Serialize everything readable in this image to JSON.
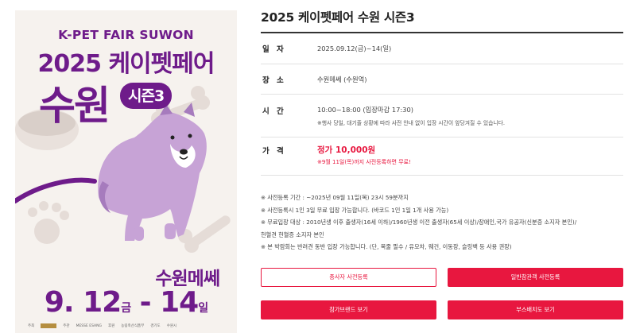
{
  "poster": {
    "title_en": "K-PET FAIR SUWON",
    "title_ko": "2025 케이펫페어",
    "city": "수원",
    "season": "시즌3",
    "venue": "수원메쎄",
    "date_start": "9. 12",
    "date_start_day": "금",
    "date_sep": " - ",
    "date_end": "14",
    "date_end_day": "일",
    "sponsors": [
      "주최",
      "주관",
      "MESSE ESANG",
      "후원",
      "농림축산식품부",
      "경기도",
      "수원시"
    ],
    "colors": {
      "brand": "#6e1b8a",
      "dog": "#c7a3d6",
      "background": "#f6f2ee"
    }
  },
  "event": {
    "title": "2025 케이펫페어 수원 시즌3",
    "rows": {
      "date": {
        "label": "일 자",
        "value": "2025.09.12(금)~14(일)"
      },
      "place": {
        "label": "장 소",
        "value": "수원메쎄 (수원역)"
      },
      "time": {
        "label": "시 간",
        "value": "10:00~18:00 (입장마감 17:30)",
        "note": "※행사 당일, 대기줄 상황에 따라 사전 안내 없이 입장 시간이 앞당겨질 수 있습니다."
      },
      "price": {
        "label": "가 격",
        "value": "정가 10,000원",
        "note": "※9월 11일(목)까지 사전등록하면 무료!"
      }
    },
    "notes": [
      "※ 사전등록 기간 : ~2025년 09월 11일(목) 23시 59분까지",
      "※ 사전등록시 1인 3일 무료 입장 가능합니다. (바코드 1인 1일 1개 사용 가능)",
      "※ 무료입장 대상 : 2010년생 이후 출생자(16세 이하)/1960년생 이전 출생자(65세 이상)/장애인,국가 유공자(신분증 소지자 본인)/",
      "헌혈견 헌혈증 소지자 본인",
      "※ 본 박람회는 반려견 동반 입장 가능합니다. (단, 목줄 필수 / 유모차, 웨건, 이동장, 슬링백 등 사용 권장)"
    ],
    "buttons": {
      "exhibitor": "종사자 사전등록",
      "visitor": "일반참관객 사전등록",
      "brands": "참가브랜드 보기",
      "booth": "부스배치도 보기"
    },
    "colors": {
      "accent": "#e8173f",
      "text": "#333333"
    }
  }
}
